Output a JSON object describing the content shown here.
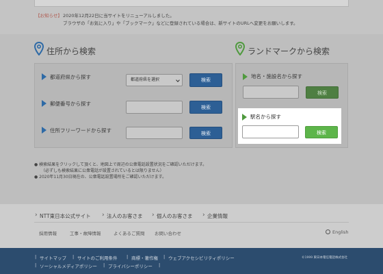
{
  "notice": {
    "tag": "【お知らせ】",
    "line1": "2020年12月22日に当サイトをリニューアルしました。",
    "line2": "ブラウザの「お気に入り」や「ブックマーク」などに登録されている場合は、新サイトのURLへ変更をお願いします。"
  },
  "address_search": {
    "title": "住所から検索",
    "rows": [
      {
        "label": "都道府県から探す",
        "select_value": "都道府県を選択",
        "button": "検索"
      },
      {
        "label": "郵便番号から探す",
        "input_value": "",
        "button": "検索"
      },
      {
        "label": "住所フリーワードから探す",
        "input_value": "",
        "button": "検索"
      }
    ]
  },
  "landmark_search": {
    "title": "ランドマークから検索",
    "rows": [
      {
        "label": "地名・施設名から探す",
        "input_value": "",
        "button": "検索"
      },
      {
        "label": "駅名から探す",
        "input_value": "",
        "button": "検索"
      }
    ]
  },
  "notes": [
    "● 検索結果をクリックして頂くと、地図上で周辺の公衆電話設置状況をご確認いただけます。",
    "（必ずしも検索結果に公衆電話が設置されているとは限りません）",
    "● 2020年11月30日現在の、公衆電話設置場所をご確認いただけます。"
  ],
  "links": {
    "primary": [
      "NTT東日本公式サイト",
      "法人のお客さま",
      "個人のお客さま",
      "企業情報"
    ],
    "secondary": [
      "採用情報",
      "工事・故障情報",
      "よくあるご質問",
      "お問い合わせ"
    ],
    "language": "English"
  },
  "footer": {
    "row1": [
      "サイトマップ",
      "サイトのご利用条件",
      "商標・著作権",
      "ウェブアクセシビリティポリシー"
    ],
    "row2": [
      "ソーシャルメディアポリシー",
      "プライバシーポリシー"
    ],
    "copyright": "©1999 東日本電信電話株式会社"
  },
  "colors": {
    "blue_button": "#2d5f95",
    "green_button": "#5db54a",
    "footer_bg": "#2c4c6e",
    "pin_blue": "#2e6aa6",
    "pin_green": "#4f9a3e"
  }
}
